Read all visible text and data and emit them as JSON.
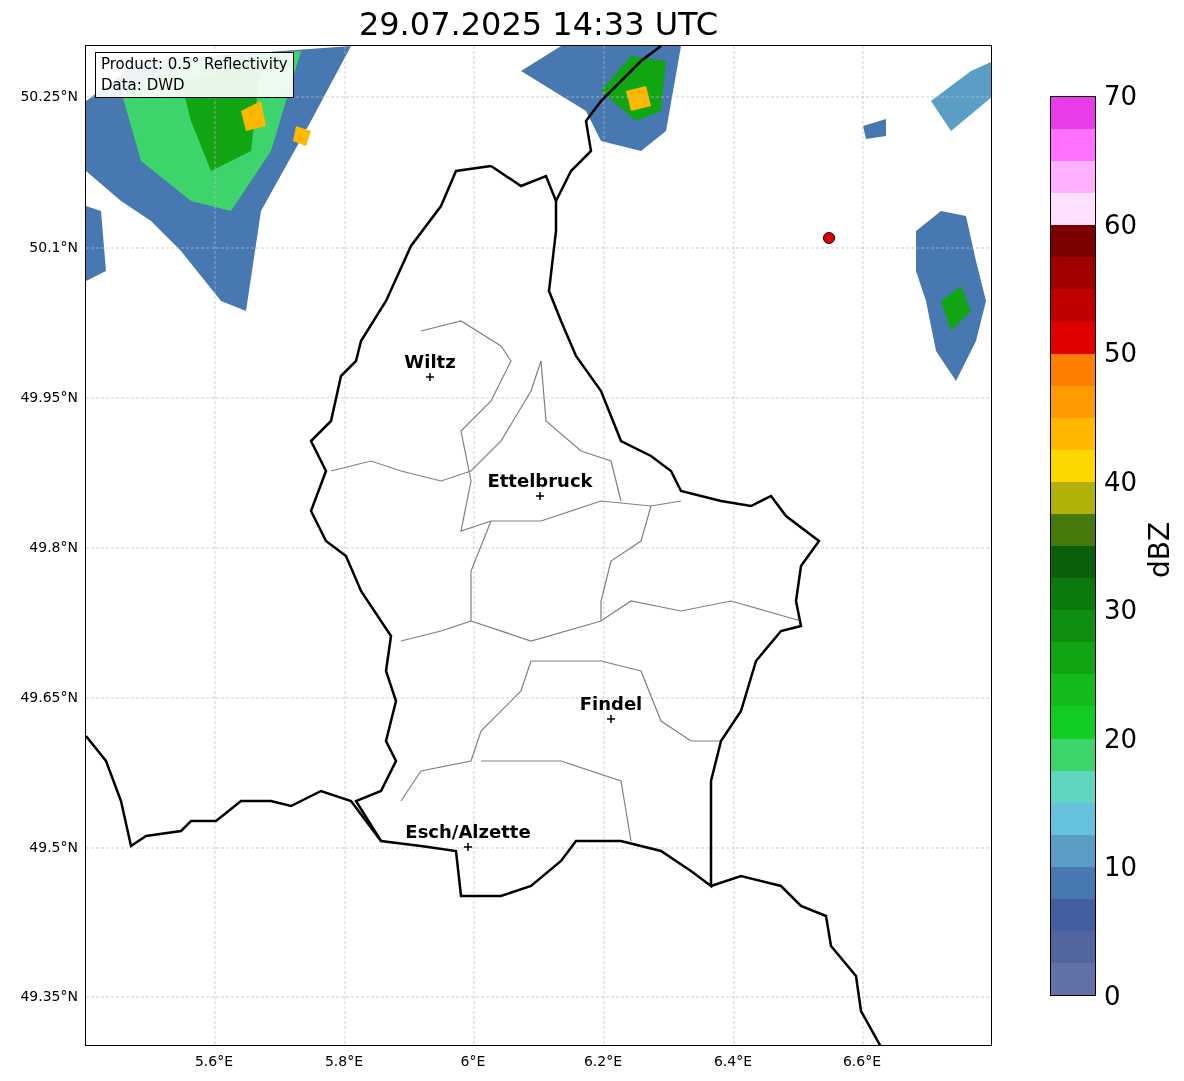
{
  "title": "29.07.2025 14:33 UTC",
  "info_box": {
    "lines": [
      "Product: 0.5° Reflectivity",
      "Data: DWD"
    ]
  },
  "lat_ticks": [
    "50.25°N",
    "50.1°N",
    "49.95°N",
    "49.8°N",
    "49.65°N",
    "49.5°N",
    "49.35°N"
  ],
  "lon_ticks": [
    "5.6°E",
    "5.8°E",
    "6°E",
    "6.2°E",
    "6.4°E",
    "6.6°E"
  ],
  "cities": [
    {
      "name": "Wiltz"
    },
    {
      "name": "Ettelbruck"
    },
    {
      "name": "Findel"
    },
    {
      "name": "Esch/Alzette"
    }
  ],
  "colorbar": {
    "label": "dBZ",
    "ticks": [
      "70",
      "60",
      "50",
      "40",
      "30",
      "20",
      "10",
      "0"
    ],
    "bands": [
      {
        "color": "#e83ce8"
      },
      {
        "color": "#ff70ff"
      },
      {
        "color": "#ffb0ff"
      },
      {
        "color": "#ffe0ff"
      },
      {
        "color": "#7c0000"
      },
      {
        "color": "#a00000"
      },
      {
        "color": "#c00000"
      },
      {
        "color": "#e00000"
      },
      {
        "color": "#ff7d00"
      },
      {
        "color": "#ff9a00"
      },
      {
        "color": "#ffb700"
      },
      {
        "color": "#ffd700"
      },
      {
        "color": "#b0b20a"
      },
      {
        "color": "#467a0c"
      },
      {
        "color": "#0a5f0a"
      },
      {
        "color": "#0b7a0c"
      },
      {
        "color": "#0f8f10"
      },
      {
        "color": "#11a513"
      },
      {
        "color": "#12bb1a"
      },
      {
        "color": "#11cc22"
      },
      {
        "color": "#3dd46b"
      },
      {
        "color": "#5fd7c0"
      },
      {
        "color": "#66c2dc"
      },
      {
        "color": "#5a9ec6"
      },
      {
        "color": "#4878b1"
      },
      {
        "color": "#435fa2"
      },
      {
        "color": "#52659f"
      },
      {
        "color": "#6272a8"
      }
    ]
  }
}
